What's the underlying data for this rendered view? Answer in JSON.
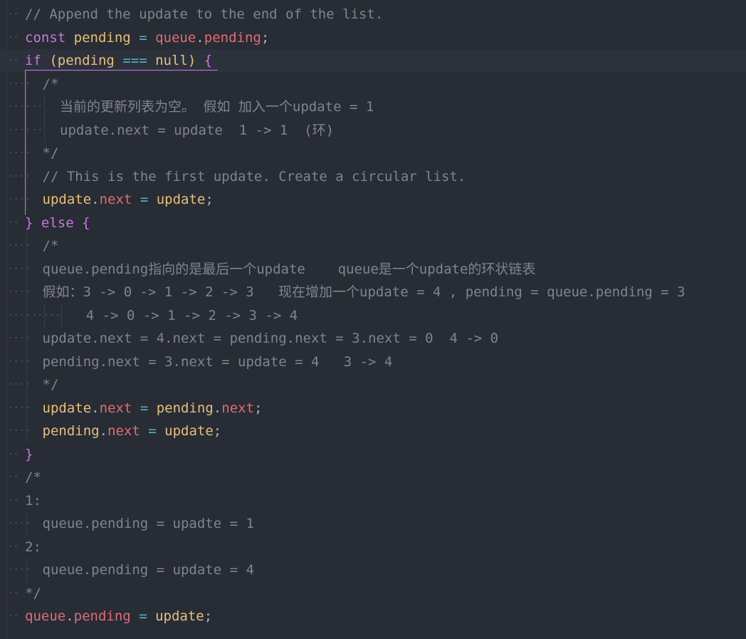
{
  "editor": {
    "language": "JavaScript",
    "colors": {
      "background": "#282c34",
      "comment": "#7f848e",
      "keyword": "#c678dd",
      "variable": "#e5c07b",
      "property": "#e06c75",
      "operator": "#56b6c2",
      "punctuation": "#abb2bf",
      "current_line": "#2c313c"
    },
    "lines": [
      {
        "indent": 0,
        "tokens": [
          {
            "t": "// Append the update to the end of the list.",
            "c": "comment"
          }
        ]
      },
      {
        "indent": 0,
        "tokens": [
          {
            "t": "const",
            "c": "kw"
          },
          {
            "t": " ",
            "c": "punc"
          },
          {
            "t": "pending",
            "c": "var"
          },
          {
            "t": " ",
            "c": "punc"
          },
          {
            "t": "=",
            "c": "op"
          },
          {
            "t": " ",
            "c": "punc"
          },
          {
            "t": "queue",
            "c": "prop"
          },
          {
            "t": ".",
            "c": "punc"
          },
          {
            "t": "pending",
            "c": "prop"
          },
          {
            "t": ";",
            "c": "punc"
          }
        ]
      },
      {
        "indent": 0,
        "current": true,
        "tokens": [
          {
            "t": "if",
            "c": "kw"
          },
          {
            "t": " (",
            "c": "var"
          },
          {
            "t": "pending",
            "c": "var"
          },
          {
            "t": " ",
            "c": "punc"
          },
          {
            "t": "===",
            "c": "op"
          },
          {
            "t": " ",
            "c": "punc"
          },
          {
            "t": "null",
            "c": "var"
          },
          {
            "t": ") ",
            "c": "var"
          },
          {
            "t": "{",
            "c": "brace"
          }
        ]
      },
      {
        "indent": 1,
        "tokens": [
          {
            "t": "/*",
            "c": "comment"
          }
        ]
      },
      {
        "indent": 2,
        "tokens": [
          {
            "t": "当前的更新列表为空。 假如 加入一个update = 1",
            "c": "comment"
          }
        ]
      },
      {
        "indent": 2,
        "tokens": [
          {
            "t": "update.next = update  1 -> 1  (环)",
            "c": "comment"
          }
        ]
      },
      {
        "indent": 1,
        "tokens": [
          {
            "t": "*/",
            "c": "comment"
          }
        ]
      },
      {
        "indent": 1,
        "tokens": [
          {
            "t": "// This is the first update. Create a circular list.",
            "c": "comment"
          }
        ]
      },
      {
        "indent": 1,
        "tokens": [
          {
            "t": "update",
            "c": "var"
          },
          {
            "t": ".",
            "c": "punc"
          },
          {
            "t": "next",
            "c": "prop"
          },
          {
            "t": " ",
            "c": "punc"
          },
          {
            "t": "=",
            "c": "op"
          },
          {
            "t": " ",
            "c": "punc"
          },
          {
            "t": "update",
            "c": "var"
          },
          {
            "t": ";",
            "c": "punc"
          }
        ]
      },
      {
        "indent": 0,
        "tokens": [
          {
            "t": "}",
            "c": "brace"
          },
          {
            "t": " ",
            "c": "punc"
          },
          {
            "t": "else",
            "c": "kw"
          },
          {
            "t": " ",
            "c": "punc"
          },
          {
            "t": "{",
            "c": "brace"
          }
        ]
      },
      {
        "indent": 1,
        "tokens": [
          {
            "t": "/*",
            "c": "comment"
          }
        ]
      },
      {
        "indent": 1,
        "tokens": [
          {
            "t": "queue.pending指向的是最后一个update    queue是一个update的环状链表",
            "c": "comment"
          }
        ]
      },
      {
        "indent": 1,
        "tokens": [
          {
            "t": "假如：3 -> 0 -> 1 -> 2 -> 3   现在增加一个update = 4 , pending = queue.pending = 3",
            "c": "comment"
          }
        ]
      },
      {
        "indent": 3.5,
        "tokens": [
          {
            "t": "4 -> 0 -> 1 -> 2 -> 3 -> 4",
            "c": "comment"
          }
        ]
      },
      {
        "indent": 1,
        "tokens": [
          {
            "t": "update.next = 4.next = pending.next = 3.next = 0  4 -> 0",
            "c": "comment"
          }
        ]
      },
      {
        "indent": 1,
        "tokens": [
          {
            "t": "pending.next = 3.next = update = 4   3 -> 4",
            "c": "comment"
          }
        ]
      },
      {
        "indent": 1,
        "tokens": [
          {
            "t": "*/",
            "c": "comment"
          }
        ]
      },
      {
        "indent": 1,
        "tokens": [
          {
            "t": "update",
            "c": "var"
          },
          {
            "t": ".",
            "c": "punc"
          },
          {
            "t": "next",
            "c": "prop"
          },
          {
            "t": " ",
            "c": "punc"
          },
          {
            "t": "=",
            "c": "op"
          },
          {
            "t": " ",
            "c": "punc"
          },
          {
            "t": "pending",
            "c": "var"
          },
          {
            "t": ".",
            "c": "punc"
          },
          {
            "t": "next",
            "c": "prop"
          },
          {
            "t": ";",
            "c": "punc"
          }
        ]
      },
      {
        "indent": 1,
        "tokens": [
          {
            "t": "pending",
            "c": "var"
          },
          {
            "t": ".",
            "c": "punc"
          },
          {
            "t": "next",
            "c": "prop"
          },
          {
            "t": " ",
            "c": "punc"
          },
          {
            "t": "=",
            "c": "op"
          },
          {
            "t": " ",
            "c": "punc"
          },
          {
            "t": "update",
            "c": "var"
          },
          {
            "t": ";",
            "c": "punc"
          }
        ]
      },
      {
        "indent": 0,
        "tokens": [
          {
            "t": "}",
            "c": "brace"
          }
        ]
      },
      {
        "indent": 0,
        "tokens": [
          {
            "t": "/*",
            "c": "comment"
          }
        ]
      },
      {
        "indent": 0,
        "tokens": [
          {
            "t": "1:",
            "c": "comment"
          }
        ]
      },
      {
        "indent": 1,
        "tokens": [
          {
            "t": "queue.pending = upadte = 1",
            "c": "comment"
          }
        ]
      },
      {
        "indent": 0,
        "tokens": [
          {
            "t": "2:",
            "c": "comment"
          }
        ]
      },
      {
        "indent": 1,
        "tokens": [
          {
            "t": "queue.pending = update = 4",
            "c": "comment"
          }
        ]
      },
      {
        "indent": 0,
        "tokens": [
          {
            "t": "*/",
            "c": "comment"
          }
        ]
      },
      {
        "indent": 0,
        "tokens": [
          {
            "t": "queue",
            "c": "prop"
          },
          {
            "t": ".",
            "c": "punc"
          },
          {
            "t": "pending",
            "c": "prop"
          },
          {
            "t": " ",
            "c": "punc"
          },
          {
            "t": "=",
            "c": "op"
          },
          {
            "t": " ",
            "c": "punc"
          },
          {
            "t": "update",
            "c": "var"
          },
          {
            "t": ";",
            "c": "punc"
          }
        ]
      }
    ]
  }
}
